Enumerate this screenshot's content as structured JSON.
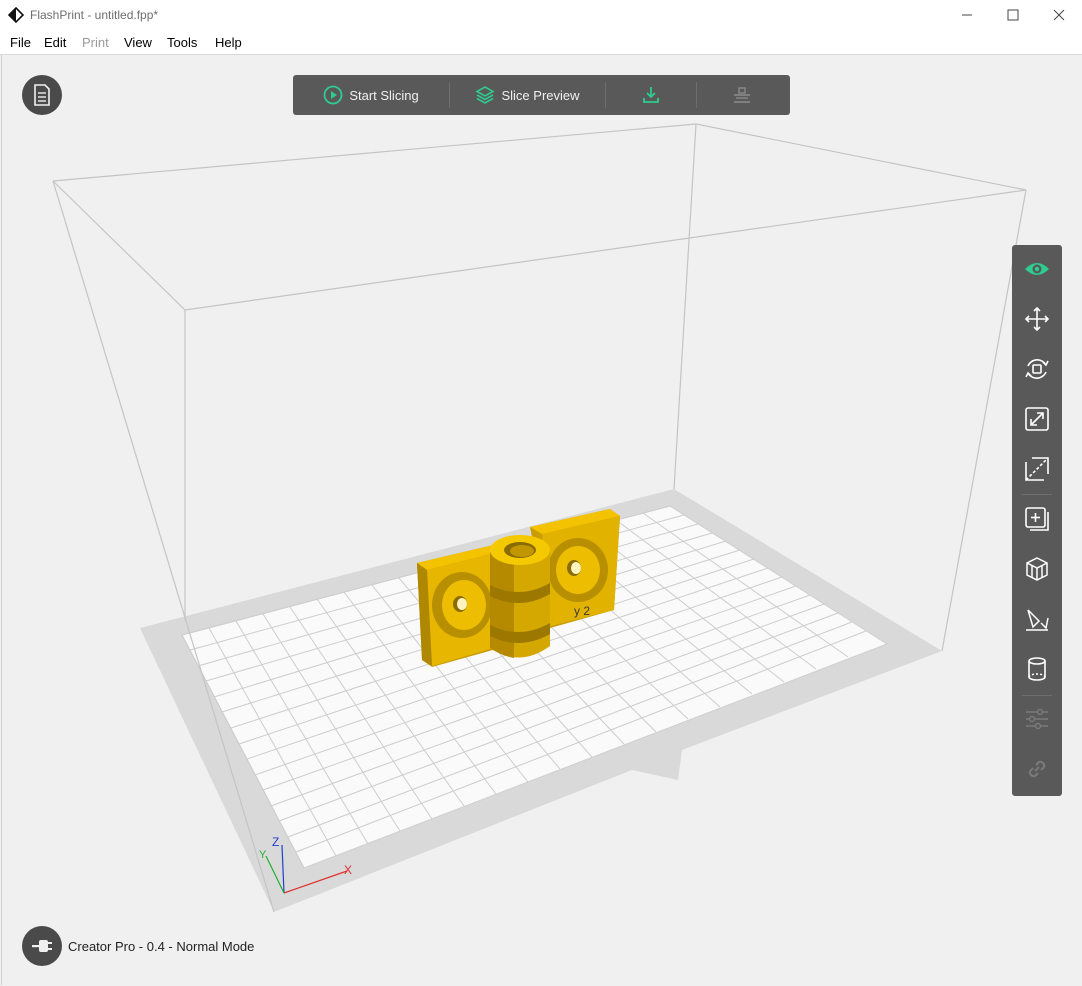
{
  "window": {
    "title": "FlashPrint - untitled.fpp*",
    "icon": "flashprint-logo-icon",
    "controls": [
      "minimize-icon",
      "maximize-icon",
      "close-icon"
    ]
  },
  "menu": {
    "items": [
      {
        "label": "File",
        "enabled": true
      },
      {
        "label": "Edit",
        "enabled": true
      },
      {
        "label": "Print",
        "enabled": false
      },
      {
        "label": "View",
        "enabled": true
      },
      {
        "label": "Tools",
        "enabled": true
      },
      {
        "label": "Help",
        "enabled": true
      }
    ]
  },
  "toolbar": {
    "start_slicing": "Start Slicing",
    "slice_preview": "Slice Preview",
    "export_icon": "download-icon",
    "print_icon": "printer-connect-icon"
  },
  "sidepanel": {
    "tools": [
      {
        "icon": "eye-icon",
        "active": true
      },
      {
        "icon": "move-icon",
        "active": false
      },
      {
        "icon": "rotate-icon",
        "active": false
      },
      {
        "icon": "scale-icon",
        "active": false
      },
      {
        "icon": "cut-icon",
        "active": false
      },
      {
        "icon": "add-object-icon",
        "active": false
      },
      {
        "icon": "supports-icon",
        "active": false
      },
      {
        "icon": "lay-flat-icon",
        "active": false
      },
      {
        "icon": "cylinder-icon",
        "active": false
      },
      {
        "icon": "settings-sliders-icon",
        "active": false,
        "disabled": true
      },
      {
        "icon": "link-icon",
        "active": false,
        "disabled": true
      }
    ]
  },
  "axes": {
    "x": "X",
    "y": "Y",
    "z": "Z"
  },
  "model": {
    "label": "y 2"
  },
  "status": {
    "printer": "Creator Pro - 0.4 - Normal Mode"
  },
  "colors": {
    "accent": "#2ecc8f",
    "model": "#e0b000",
    "panel": "#595959"
  }
}
